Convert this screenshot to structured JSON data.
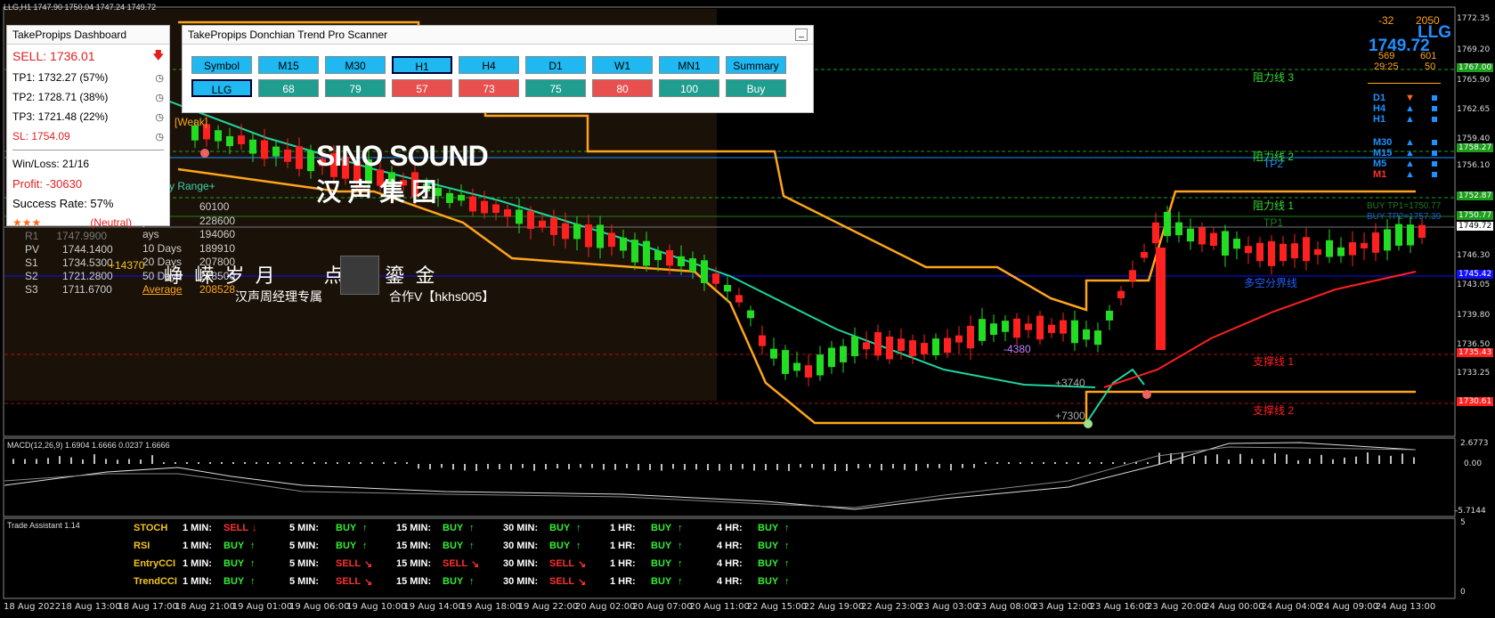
{
  "window": {
    "title": "LLG,H1  1747.90 1750.04 1747.24 1749.72"
  },
  "dashboard": {
    "title": "TakePropips Dashboard",
    "signal": "SELL: 1736.01",
    "tp1": "TP1: 1732.27 (57%)",
    "tp2": "TP2: 1728.71 (38%)",
    "tp3": "TP3: 1721.48 (22%)",
    "sl": "SL:  1754.09",
    "winloss": "Win/Loss: 21/16",
    "profit": "Profit: -30630",
    "success": "Success Rate: 57%",
    "stars": "★★★",
    "neutral": "(Neutral)"
  },
  "scanner": {
    "title": "TakePropips Donchian Trend Pro Scanner",
    "headers": [
      "Symbol",
      "M15",
      "M30",
      "H1",
      "H4",
      "D1",
      "W1",
      "MN1",
      "Summary"
    ],
    "values": [
      "LLG",
      "68",
      "79",
      "57",
      "73",
      "75",
      "80",
      "100",
      "Buy"
    ],
    "colors": [
      "sym",
      "grn",
      "grn",
      "red",
      "red",
      "grn",
      "red",
      "grn",
      "grn"
    ]
  },
  "pivots": {
    "rows": [
      {
        "name": "PV",
        "value": "1744.1400"
      },
      {
        "name": "S1",
        "value": "1734.5300"
      },
      {
        "name": "S2",
        "value": "1721.2800"
      },
      {
        "name": "S3",
        "value": "1711.6700"
      }
    ],
    "r1_label": "R1",
    "r1_value": "1747.9900",
    "range_title": "y Range+",
    "ranges": [
      {
        "label": "y",
        "value": "60100"
      },
      {
        "label": "ys",
        "value": "228600"
      },
      {
        "label": "ays",
        "value": "194060"
      },
      {
        "label": "10 Days",
        "value": "189910"
      },
      {
        "label": "20 Days",
        "value": "207800"
      },
      {
        "label": "50 Days",
        "value": "228500"
      },
      {
        "label": "Average",
        "value": "208528"
      }
    ],
    "plus_label": "+14370"
  },
  "watermark": {
    "brand": "SINO SOUND",
    "brand_cn": "汉 声 集 团",
    "slogan": "峥  嵘  岁  月         点  滴  鎏  金",
    "sub1": "汉声周经理专属",
    "sub2": "合作V【hkhs005】"
  },
  "chart_labels": {
    "resist3": "阻力线 3",
    "resist2": "阻力线 2",
    "resist1": "阻力线 1",
    "tp2": "TP2",
    "tp1": "TP1",
    "buy_tp1": "BUY TP1=1750.77",
    "buy_tp2": "BUY TP2=1757.39",
    "split": "多空分界线",
    "support1": "支撑线 1",
    "support2": "支撑线 2",
    "m4380": "-4380",
    "p3740": "+3740",
    "p7300": "+7300",
    "weak": "[Weak]"
  },
  "top_right": {
    "n1": "-32",
    "n2": "2050",
    "symbol": "LLG",
    "price": "1749.72",
    "a1": "569",
    "a2": "601",
    "b1": "29:25",
    "b2": "50"
  },
  "tf_trend": [
    {
      "tf": "D1",
      "dir": "▼",
      "color": "#1e90ff",
      "arrow_color": "#ff6a1a"
    },
    {
      "tf": "H4",
      "dir": "▲",
      "color": "#1e90ff",
      "arrow_color": "#1e90ff"
    },
    {
      "tf": "H1",
      "dir": "▲",
      "color": "#1e90ff",
      "arrow_color": "#1e90ff"
    },
    {
      "tf": "M30",
      "dir": "▲",
      "color": "#1e90ff",
      "arrow_color": "#1e90ff"
    },
    {
      "tf": "M15",
      "dir": "▲",
      "color": "#1e90ff",
      "arrow_color": "#1e90ff"
    },
    {
      "tf": "M5",
      "dir": "▲",
      "color": "#1e90ff",
      "arrow_color": "#1e90ff"
    },
    {
      "tf": "M1",
      "dir": "▲",
      "color": "#ff3030",
      "arrow_color": "#1e90ff"
    }
  ],
  "price_axis": [
    "1772.35",
    "1769.20",
    "1767.00",
    "1765.90",
    "1762.65",
    "1759.40",
    "1758.27",
    "1756.10",
    "1752.87",
    "1750.77",
    "1749.72",
    "1746.30",
    "1745.42",
    "1743.05",
    "1739.80",
    "1736.50",
    "1735.43",
    "1733.25",
    "1730.61"
  ],
  "macd": {
    "label": "MACD(12,26,9) 1.6904 1.6666 0.0237 1.6666",
    "ticks": [
      "2.6773",
      "0.00",
      "-5.7144"
    ]
  },
  "assistant": {
    "title": "Trade Assistant 1.14",
    "rows": [
      {
        "name": "STOCH",
        "cells": [
          [
            "1 MIN:",
            "SELL",
            "↓"
          ],
          [
            "5 MIN:",
            "BUY",
            "↑"
          ],
          [
            "15 MIN:",
            "BUY",
            "↑"
          ],
          [
            "30 MIN:",
            "BUY",
            "↑"
          ],
          [
            "1 HR:",
            "BUY",
            "↑"
          ],
          [
            "4 HR:",
            "BUY",
            "↑"
          ]
        ]
      },
      {
        "name": "RSI",
        "cells": [
          [
            "1 MIN:",
            "BUY",
            "↑"
          ],
          [
            "5 MIN:",
            "BUY",
            "↑"
          ],
          [
            "15 MIN:",
            "BUY",
            "↑"
          ],
          [
            "30 MIN:",
            "BUY",
            "↑"
          ],
          [
            "1 HR:",
            "BUY",
            "↑"
          ],
          [
            "4 HR:",
            "BUY",
            "↑"
          ]
        ]
      },
      {
        "name": "EntryCCI",
        "cells": [
          [
            "1 MIN:",
            "BUY",
            "↑"
          ],
          [
            "5 MIN:",
            "SELL",
            "↘"
          ],
          [
            "15 MIN:",
            "SELL",
            "↘"
          ],
          [
            "30 MIN:",
            "SELL",
            "↘"
          ],
          [
            "1 HR:",
            "BUY",
            "↑"
          ],
          [
            "4 HR:",
            "BUY",
            "↑"
          ]
        ]
      },
      {
        "name": "TrendCCI",
        "cells": [
          [
            "1 MIN:",
            "BUY",
            "↑"
          ],
          [
            "5 MIN:",
            "SELL",
            "↘"
          ],
          [
            "15 MIN:",
            "BUY",
            "↑"
          ],
          [
            "30 MIN:",
            "SELL",
            "↘"
          ],
          [
            "1 HR:",
            "BUY",
            "↑"
          ],
          [
            "4 HR:",
            "BUY",
            "↑"
          ]
        ]
      }
    ],
    "ticks": [
      "5",
      "0"
    ]
  },
  "time_axis": [
    "18 Aug 2022",
    "18 Aug 13:00",
    "18 Aug 17:00",
    "18 Aug 21:00",
    "19 Aug 01:00",
    "19 Aug 06:00",
    "19 Aug 10:00",
    "19 Aug 14:00",
    "19 Aug 18:00",
    "19 Aug 22:00",
    "20 Aug 02:00",
    "20 Aug 07:00",
    "20 Aug 11:00",
    "22 Aug 15:00",
    "22 Aug 19:00",
    "22 Aug 23:00",
    "23 Aug 03:00",
    "23 Aug 08:00",
    "23 Aug 12:00",
    "23 Aug 16:00",
    "23 Aug 20:00",
    "24 Aug 00:00",
    "24 Aug 04:00",
    "24 Aug 09:00",
    "24 Aug 13:00"
  ],
  "colors": {
    "bull": "#22dd22",
    "bear": "#ff2020",
    "donchian": "#ffa41b",
    "ma_green": "#1ed4a0",
    "ma_red": "#ff2020",
    "split_line": "#1010ff"
  }
}
